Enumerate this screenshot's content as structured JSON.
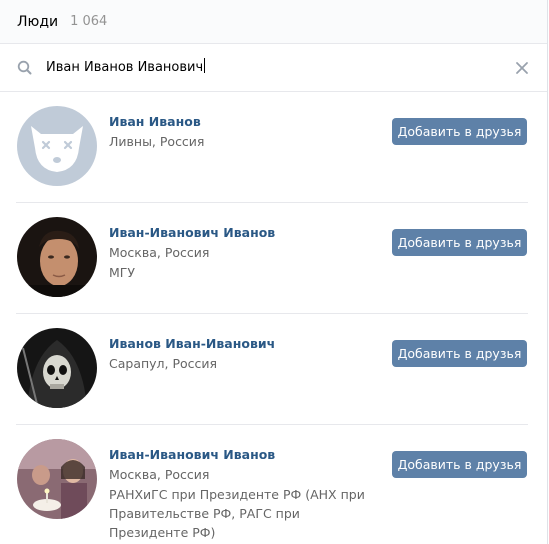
{
  "header": {
    "title": "Люди",
    "count": "1 064"
  },
  "search": {
    "query": "Иван Иванов Иванович"
  },
  "colors": {
    "link": "#2a5885",
    "button": "#5e81a8",
    "meta": "#656565",
    "count": "#939393"
  },
  "results": [
    {
      "name": "Иван Иванов",
      "location": "Ливны, Россия",
      "extra": "",
      "button": "Добавить в друзья",
      "avatar": "default-camera-avatar"
    },
    {
      "name": "Иван-Иванович Иванов",
      "location": "Москва, Россия",
      "extra": "МГУ",
      "button": "Добавить в друзья",
      "avatar": "young-man-photo"
    },
    {
      "name": "Иванов Иван-Иванович",
      "location": "Сарапул, Россия",
      "extra": "",
      "button": "Добавить в друзья",
      "avatar": "skull-reaper-photo"
    },
    {
      "name": "Иван-Иванович Иванов",
      "location": "Москва, Россия",
      "extra": "РАНХиГС при Президенте РФ (АНХ при Правительстве РФ, РАГС при Президенте РФ)",
      "button": "Добавить в друзья",
      "avatar": "family-birthday-photo"
    }
  ]
}
